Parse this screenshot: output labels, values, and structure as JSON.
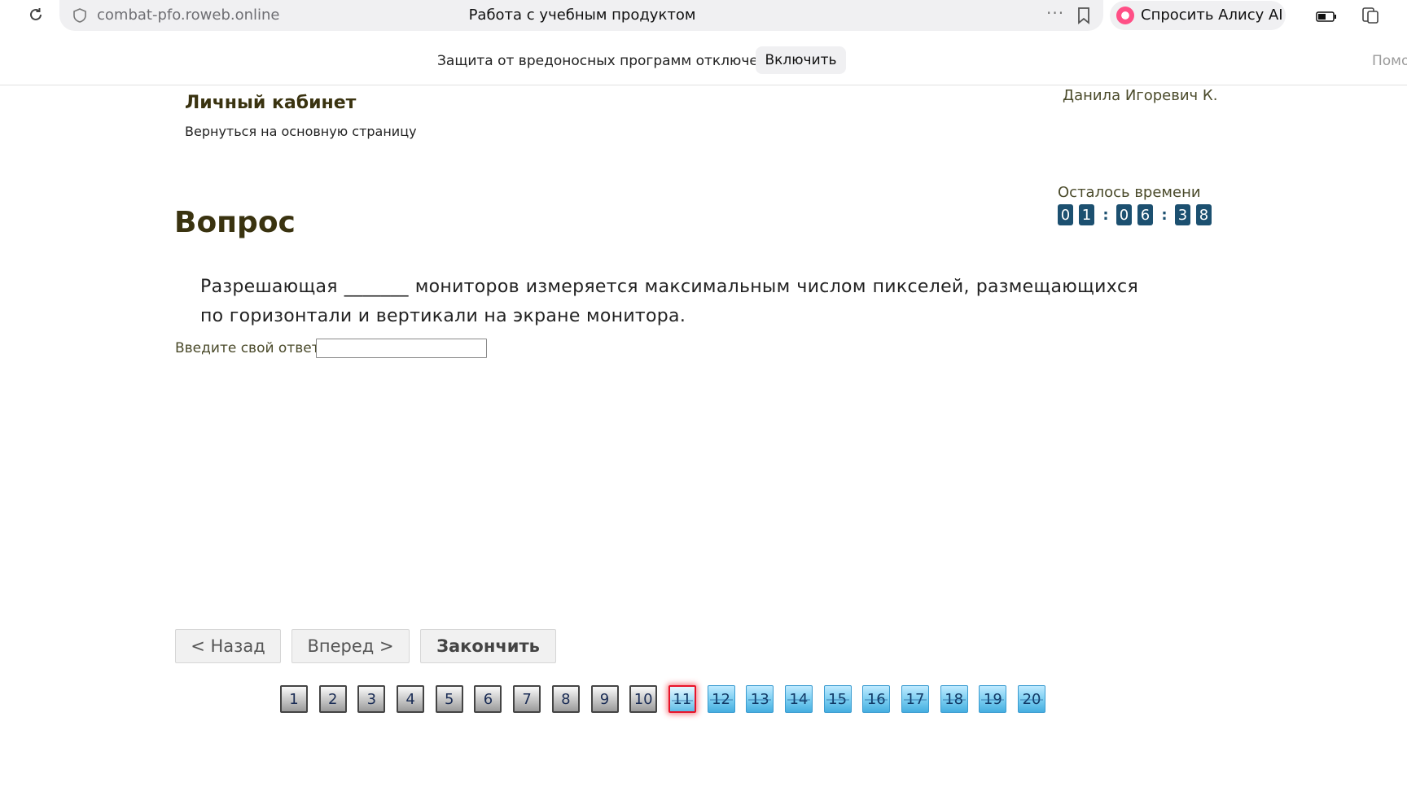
{
  "browser": {
    "url": "combat-pfo.roweb.online",
    "tab_title": "Работа с учебным продуктом",
    "more_label": "···",
    "alice_label": "Спросить Алису AI"
  },
  "notice": {
    "text": "Защита от вредоносных программ отключена",
    "enable_label": "Включить",
    "help_label": "Помощь"
  },
  "header": {
    "cabinet_title": "Личный кабинет",
    "back_link": "Вернуться на основную страницу",
    "user_name": "Данила Игоревич К."
  },
  "timer": {
    "label": "Осталось времени",
    "digits": [
      "0",
      "1",
      "0",
      "6",
      "3",
      "8"
    ],
    "separator": ":"
  },
  "question": {
    "heading": "Вопрос",
    "text": "Разрешающая _______ мониторов измеряется максимальным числом пикселей, размещающихся по горизонтали и вертикали на экране монитора.",
    "answer_label": "Введите свой ответ",
    "answer_value": ""
  },
  "nav": {
    "back_label": "< Назад",
    "next_label": "Вперед >",
    "finish_label": "Закончить"
  },
  "pages": {
    "items": [
      "1",
      "2",
      "3",
      "4",
      "5",
      "6",
      "7",
      "8",
      "9",
      "10",
      "11",
      "12",
      "13",
      "14",
      "15",
      "16",
      "17",
      "18",
      "19",
      "20"
    ],
    "current": 11,
    "answered_through": 10
  },
  "colors": {
    "heading": "#3a3310",
    "timer_digit_bg": "#1c5070",
    "page_current_border": "#e8142a",
    "page_todo": "#7fd0f2"
  }
}
